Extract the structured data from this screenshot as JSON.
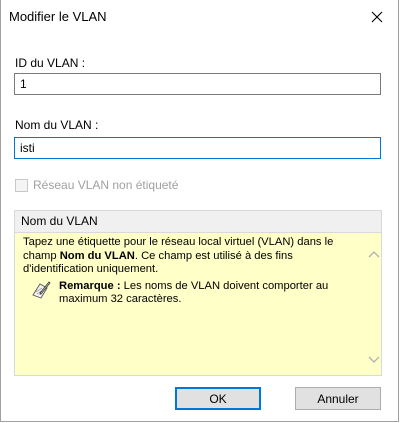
{
  "dialog": {
    "title": "Modifier le VLAN"
  },
  "vlan_id": {
    "label": "ID du VLAN :",
    "value": "1"
  },
  "vlan_name": {
    "label": "Nom du VLAN :",
    "value": "isti"
  },
  "untagged": {
    "label": "Réseau VLAN non étiqueté",
    "checked": false,
    "enabled": false
  },
  "help": {
    "header": "Nom du VLAN",
    "text_before": "Tapez une étiquette pour le réseau local virtuel (VLAN) dans le champ ",
    "text_bold": "Nom du VLAN",
    "text_after": ". Ce champ est utilisé à des fins d'identification uniquement.",
    "note_label": "Remarque :",
    "note_text": " Les noms de VLAN doivent comporter au maximum 32 caractères.",
    "background": "#ffffc8"
  },
  "buttons": {
    "ok": "OK",
    "cancel": "Annuler"
  },
  "icons": {
    "close": "close-icon",
    "note": "note-pencil-icon",
    "scroll_up": "chevron-up-icon",
    "scroll_down": "chevron-down-icon"
  }
}
